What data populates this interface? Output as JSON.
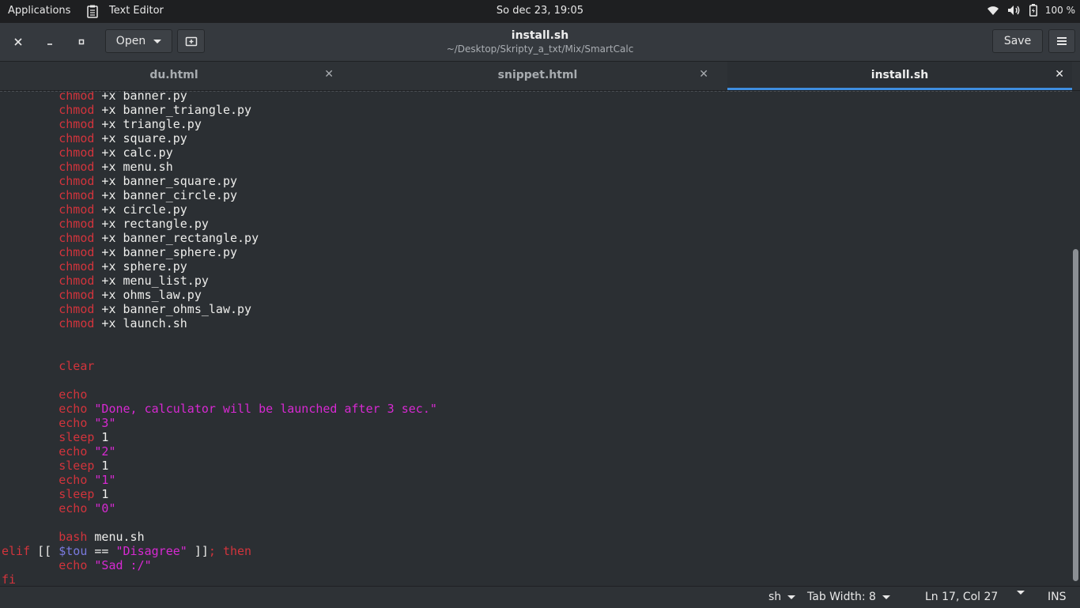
{
  "top_panel": {
    "applications": "Applications",
    "app_name": "Text Editor",
    "clock": "So dec 23, 19:05",
    "battery": "100 %"
  },
  "header": {
    "open_label": "Open",
    "title": "install.sh",
    "subtitle": "~/Desktop/Skripty_a_txt/Mix/SmartCalc",
    "save_label": "Save"
  },
  "tabs": [
    {
      "label": "du.html"
    },
    {
      "label": "snippet.html"
    },
    {
      "label": "install.sh"
    }
  ],
  "code": [
    [
      [
        "        ",
        ""
      ],
      [
        "chmod",
        "kw"
      ],
      [
        " +x banner.py",
        ""
      ]
    ],
    [
      [
        "        ",
        ""
      ],
      [
        "chmod",
        "kw"
      ],
      [
        " +x banner_triangle.py",
        ""
      ]
    ],
    [
      [
        "        ",
        ""
      ],
      [
        "chmod",
        "kw"
      ],
      [
        " +x triangle.py",
        ""
      ]
    ],
    [
      [
        "        ",
        ""
      ],
      [
        "chmod",
        "kw"
      ],
      [
        " +x square.py",
        ""
      ]
    ],
    [
      [
        "        ",
        ""
      ],
      [
        "chmod",
        "kw"
      ],
      [
        " +x calc.py",
        ""
      ]
    ],
    [
      [
        "        ",
        ""
      ],
      [
        "chmod",
        "kw"
      ],
      [
        " +x menu.sh",
        ""
      ]
    ],
    [
      [
        "        ",
        ""
      ],
      [
        "chmod",
        "kw"
      ],
      [
        " +x banner_square.py",
        ""
      ]
    ],
    [
      [
        "        ",
        ""
      ],
      [
        "chmod",
        "kw"
      ],
      [
        " +x banner_circle.py",
        ""
      ]
    ],
    [
      [
        "        ",
        ""
      ],
      [
        "chmod",
        "kw"
      ],
      [
        " +x circle.py",
        ""
      ]
    ],
    [
      [
        "        ",
        ""
      ],
      [
        "chmod",
        "kw"
      ],
      [
        " +x rectangle.py",
        ""
      ]
    ],
    [
      [
        "        ",
        ""
      ],
      [
        "chmod",
        "kw"
      ],
      [
        " +x banner_rectangle.py",
        ""
      ]
    ],
    [
      [
        "        ",
        ""
      ],
      [
        "chmod",
        "kw"
      ],
      [
        " +x banner_sphere.py",
        ""
      ]
    ],
    [
      [
        "        ",
        ""
      ],
      [
        "chmod",
        "kw"
      ],
      [
        " +x sphere.py",
        ""
      ]
    ],
    [
      [
        "        ",
        ""
      ],
      [
        "chmod",
        "kw"
      ],
      [
        " +x menu_list.py",
        ""
      ]
    ],
    [
      [
        "        ",
        ""
      ],
      [
        "chmod",
        "kw"
      ],
      [
        " +x ohms_law.py",
        ""
      ]
    ],
    [
      [
        "        ",
        ""
      ],
      [
        "chmod",
        "kw"
      ],
      [
        " +x banner_ohms_law.py",
        ""
      ]
    ],
    [
      [
        "        ",
        ""
      ],
      [
        "chmod",
        "kw"
      ],
      [
        " +x launch.sh",
        ""
      ]
    ],
    [],
    [],
    [
      [
        "        ",
        ""
      ],
      [
        "clear",
        "kw"
      ]
    ],
    [],
    [
      [
        "        ",
        ""
      ],
      [
        "echo",
        "kw"
      ]
    ],
    [
      [
        "        ",
        ""
      ],
      [
        "echo",
        "kw"
      ],
      [
        " ",
        ""
      ],
      [
        "\"Done, calculator will be launched after 3 sec.\"",
        "str"
      ]
    ],
    [
      [
        "        ",
        ""
      ],
      [
        "echo",
        "kw"
      ],
      [
        " ",
        ""
      ],
      [
        "\"3\"",
        "str"
      ]
    ],
    [
      [
        "        ",
        ""
      ],
      [
        "sleep",
        "kw"
      ],
      [
        " 1",
        ""
      ]
    ],
    [
      [
        "        ",
        ""
      ],
      [
        "echo",
        "kw"
      ],
      [
        " ",
        ""
      ],
      [
        "\"2\"",
        "str"
      ]
    ],
    [
      [
        "        ",
        ""
      ],
      [
        "sleep",
        "kw"
      ],
      [
        " 1",
        ""
      ]
    ],
    [
      [
        "        ",
        ""
      ],
      [
        "echo",
        "kw"
      ],
      [
        " ",
        ""
      ],
      [
        "\"1\"",
        "str"
      ]
    ],
    [
      [
        "        ",
        ""
      ],
      [
        "sleep",
        "kw"
      ],
      [
        " 1",
        ""
      ]
    ],
    [
      [
        "        ",
        ""
      ],
      [
        "echo",
        "kw"
      ],
      [
        " ",
        ""
      ],
      [
        "\"0\"",
        "str"
      ]
    ],
    [],
    [
      [
        "        ",
        ""
      ],
      [
        "bash",
        "kw"
      ],
      [
        " menu.sh",
        ""
      ]
    ],
    [
      [
        "elif",
        "kw"
      ],
      [
        " [[ ",
        ""
      ],
      [
        "$tou",
        "var"
      ],
      [
        " == ",
        ""
      ],
      [
        "\"Disagree\"",
        "str"
      ],
      [
        " ]]",
        ""
      ],
      [
        "; then",
        "kw"
      ]
    ],
    [
      [
        "        ",
        ""
      ],
      [
        "echo",
        "kw"
      ],
      [
        " ",
        ""
      ],
      [
        "\"Sad :/\"",
        "str"
      ]
    ],
    [
      [
        "fi",
        "kw"
      ]
    ]
  ],
  "status": {
    "language": "sh",
    "tab_width": "Tab Width: 8",
    "position": "Ln 17, Col 27",
    "mode": "INS"
  },
  "icons": {
    "wifi": "wifi-icon",
    "volume": "volume-icon",
    "battery": "battery-icon"
  }
}
